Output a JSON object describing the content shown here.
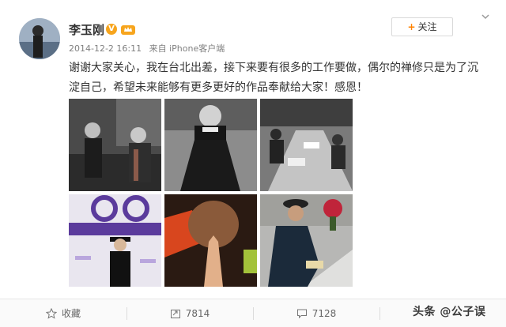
{
  "post": {
    "author": "李玉刚",
    "verified_badge": "V",
    "member_icon": "crown-member-icon",
    "timestamp": "2014-12-2 16:11",
    "source": "来自 iPhone客户端",
    "follow_label": "关注",
    "text": "谢谢大家关心，我在台北出差，接下来要有很多的工作要做，偶尔的禅修只是为了沉淀自己，希望未来能够有更多更好的作品奉献给大家！感恩！",
    "images": [
      "photo-two-men-hats-monochrome",
      "photo-man-black-sweater-monochrome",
      "photo-office-meeting-monochrome",
      "photo-man-hat-event-backdrop",
      "photo-praying-hands-closeup",
      "photo-man-hat-writing-at-desk"
    ]
  },
  "actions": {
    "favorite_label": "收藏",
    "repost_count": "7814",
    "comment_count": "7128"
  },
  "watermark": "头条 @公子误",
  "colors": {
    "accent": "#ff8200",
    "badge": "#f7a51d",
    "text": "#333333",
    "meta": "#808080"
  }
}
